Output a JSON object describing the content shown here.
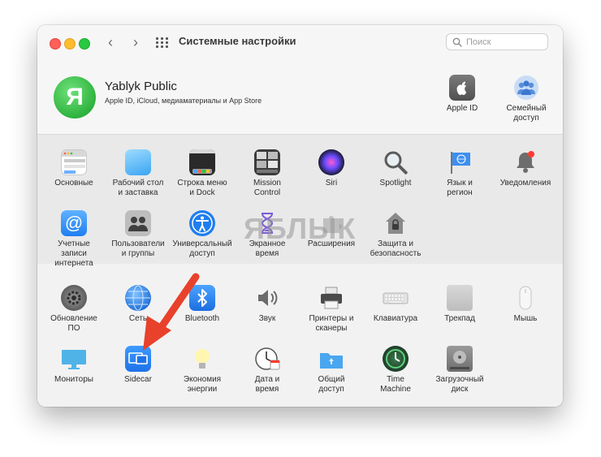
{
  "window": {
    "title": "Системные настройки"
  },
  "search": {
    "placeholder": "Поиск"
  },
  "account": {
    "initial": "Я",
    "name": "Yablyk Public",
    "subtitle": "Apple ID, iCloud, медиаматериалы и App Store"
  },
  "account_items": [
    {
      "label": "Apple ID",
      "icon": "apple-id-icon"
    },
    {
      "label": "Семейный\nдоступ",
      "icon": "family-sharing-icon"
    }
  ],
  "panes_personal": [
    {
      "label": "Основные",
      "icon": "general-icon"
    },
    {
      "label": "Рабочий стол\nи заставка",
      "icon": "desktop-icon"
    },
    {
      "label": "Строка меню\nи Dock",
      "icon": "dock-icon"
    },
    {
      "label": "Mission\nControl",
      "icon": "mission-control-icon"
    },
    {
      "label": "Siri",
      "icon": "siri-icon"
    },
    {
      "label": "Spotlight",
      "icon": "spotlight-icon"
    },
    {
      "label": "Язык и\nрегион",
      "icon": "language-icon"
    },
    {
      "label": "Уведомления",
      "icon": "notifications-icon"
    },
    {
      "label": "Учетные\nзаписи интернета",
      "icon": "internet-accounts-icon"
    },
    {
      "label": "Пользователи\nи группы",
      "icon": "users-icon"
    },
    {
      "label": "Универсальный\nдоступ",
      "icon": "accessibility-icon"
    },
    {
      "label": "Экранное\nвремя",
      "icon": "screen-time-icon"
    },
    {
      "label": "Расширения",
      "icon": "extensions-icon"
    },
    {
      "label": "Защита и\nбезопасность",
      "icon": "security-icon"
    }
  ],
  "panes_hardware": [
    {
      "label": "Обновление\nПО",
      "icon": "software-update-icon"
    },
    {
      "label": "Сеть",
      "icon": "network-icon"
    },
    {
      "label": "Bluetooth",
      "icon": "bluetooth-icon"
    },
    {
      "label": "Звук",
      "icon": "sound-icon"
    },
    {
      "label": "Принтеры и\nсканеры",
      "icon": "printer-icon"
    },
    {
      "label": "Клавиатура",
      "icon": "keyboard-icon"
    },
    {
      "label": "Трекпад",
      "icon": "trackpad-icon"
    },
    {
      "label": "Мышь",
      "icon": "mouse-icon"
    },
    {
      "label": "Мониторы",
      "icon": "displays-icon"
    },
    {
      "label": "Sidecar",
      "icon": "sidecar-icon"
    },
    {
      "label": "Экономия\nэнергии",
      "icon": "energy-icon"
    },
    {
      "label": "Дата и\nвремя",
      "icon": "date-time-icon"
    },
    {
      "label": "Общий\nдоступ",
      "icon": "sharing-icon"
    },
    {
      "label": "Time\nMachine",
      "icon": "time-machine-icon"
    },
    {
      "label": "Загрузочный\nдиск",
      "icon": "startup-disk-icon"
    }
  ],
  "watermark": "ЯБЛЫК",
  "colors": {
    "arrow": "#e8412c",
    "close": "#fe5f57",
    "minimize": "#febc2e",
    "maximize": "#28c840"
  }
}
